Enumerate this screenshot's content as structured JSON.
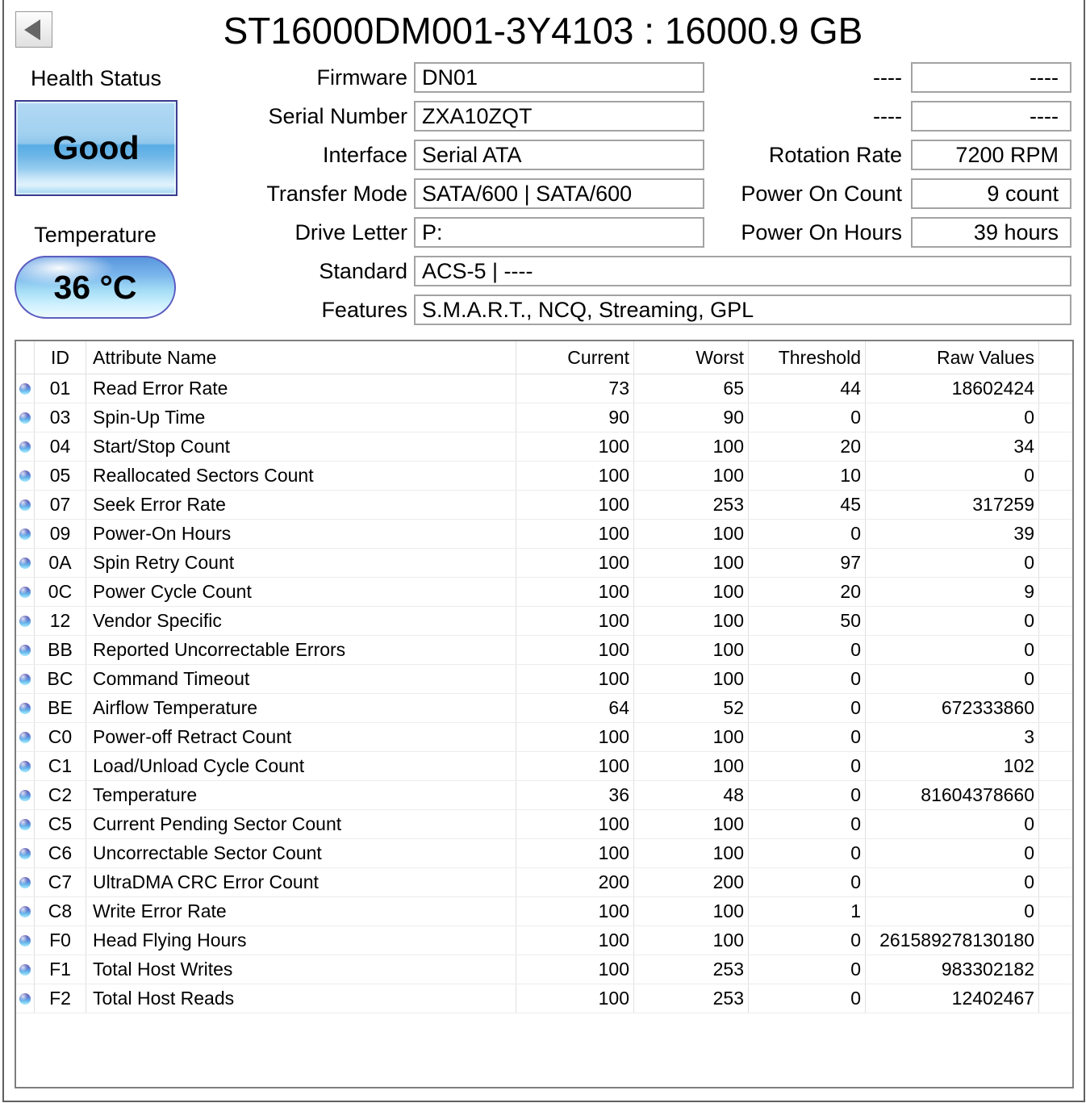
{
  "window": {
    "title": "ST16000DM001-3Y4103 : 16000.9 GB"
  },
  "colors": {
    "health_border": "#3d3d8f",
    "temp_border": "#5c5cc0",
    "orb_top": "#6a62b2",
    "orb_bottom": "#a0e4fb"
  },
  "back_button": {
    "icon": "left-arrow"
  },
  "health": {
    "label": "Health Status",
    "status": "Good"
  },
  "temperature": {
    "label": "Temperature",
    "value": "36 °C"
  },
  "info_fields": [
    {
      "label": "Firmware",
      "value": "DN01"
    },
    {
      "label": "Serial Number",
      "value": "ZXA10ZQT"
    },
    {
      "label": "Interface",
      "value": "Serial ATA"
    },
    {
      "label": "Transfer Mode",
      "value": "SATA/600 | SATA/600"
    },
    {
      "label": "Drive Letter",
      "value": "P:"
    },
    {
      "label": "Standard",
      "value": "ACS-5 | ----"
    },
    {
      "label": "Features",
      "value": "S.M.A.R.T., NCQ, Streaming, GPL"
    }
  ],
  "right_fields": [
    {
      "label": "----",
      "value": "----"
    },
    {
      "label": "----",
      "value": "----"
    },
    {
      "label": "Rotation Rate",
      "value": "7200 RPM"
    },
    {
      "label": "Power On Count",
      "value": "9 count"
    },
    {
      "label": "Power On Hours",
      "value": "39 hours"
    }
  ],
  "table": {
    "headers": {
      "id": "ID",
      "name": "Attribute Name",
      "current": "Current",
      "worst": "Worst",
      "threshold": "Threshold",
      "raw": "Raw Values"
    },
    "rows": [
      {
        "id": "01",
        "name": "Read Error Rate",
        "current": "73",
        "worst": "65",
        "threshold": "44",
        "raw": "18602424"
      },
      {
        "id": "03",
        "name": "Spin-Up Time",
        "current": "90",
        "worst": "90",
        "threshold": "0",
        "raw": "0"
      },
      {
        "id": "04",
        "name": "Start/Stop Count",
        "current": "100",
        "worst": "100",
        "threshold": "20",
        "raw": "34"
      },
      {
        "id": "05",
        "name": "Reallocated Sectors Count",
        "current": "100",
        "worst": "100",
        "threshold": "10",
        "raw": "0"
      },
      {
        "id": "07",
        "name": "Seek Error Rate",
        "current": "100",
        "worst": "253",
        "threshold": "45",
        "raw": "317259"
      },
      {
        "id": "09",
        "name": "Power-On Hours",
        "current": "100",
        "worst": "100",
        "threshold": "0",
        "raw": "39"
      },
      {
        "id": "0A",
        "name": "Spin Retry Count",
        "current": "100",
        "worst": "100",
        "threshold": "97",
        "raw": "0"
      },
      {
        "id": "0C",
        "name": "Power Cycle Count",
        "current": "100",
        "worst": "100",
        "threshold": "20",
        "raw": "9"
      },
      {
        "id": "12",
        "name": "Vendor Specific",
        "current": "100",
        "worst": "100",
        "threshold": "50",
        "raw": "0"
      },
      {
        "id": "BB",
        "name": "Reported Uncorrectable Errors",
        "current": "100",
        "worst": "100",
        "threshold": "0",
        "raw": "0"
      },
      {
        "id": "BC",
        "name": "Command Timeout",
        "current": "100",
        "worst": "100",
        "threshold": "0",
        "raw": "0"
      },
      {
        "id": "BE",
        "name": "Airflow Temperature",
        "current": "64",
        "worst": "52",
        "threshold": "0",
        "raw": "672333860"
      },
      {
        "id": "C0",
        "name": "Power-off Retract Count",
        "current": "100",
        "worst": "100",
        "threshold": "0",
        "raw": "3"
      },
      {
        "id": "C1",
        "name": "Load/Unload Cycle Count",
        "current": "100",
        "worst": "100",
        "threshold": "0",
        "raw": "102"
      },
      {
        "id": "C2",
        "name": "Temperature",
        "current": "36",
        "worst": "48",
        "threshold": "0",
        "raw": "81604378660"
      },
      {
        "id": "C5",
        "name": "Current Pending Sector Count",
        "current": "100",
        "worst": "100",
        "threshold": "0",
        "raw": "0"
      },
      {
        "id": "C6",
        "name": "Uncorrectable Sector Count",
        "current": "100",
        "worst": "100",
        "threshold": "0",
        "raw": "0"
      },
      {
        "id": "C7",
        "name": "UltraDMA CRC Error Count",
        "current": "200",
        "worst": "200",
        "threshold": "0",
        "raw": "0"
      },
      {
        "id": "C8",
        "name": "Write Error Rate",
        "current": "100",
        "worst": "100",
        "threshold": "1",
        "raw": "0"
      },
      {
        "id": "F0",
        "name": "Head Flying Hours",
        "current": "100",
        "worst": "100",
        "threshold": "0",
        "raw": "261589278130180"
      },
      {
        "id": "F1",
        "name": "Total Host Writes",
        "current": "100",
        "worst": "253",
        "threshold": "0",
        "raw": "983302182"
      },
      {
        "id": "F2",
        "name": "Total Host Reads",
        "current": "100",
        "worst": "253",
        "threshold": "0",
        "raw": "12402467"
      }
    ]
  }
}
